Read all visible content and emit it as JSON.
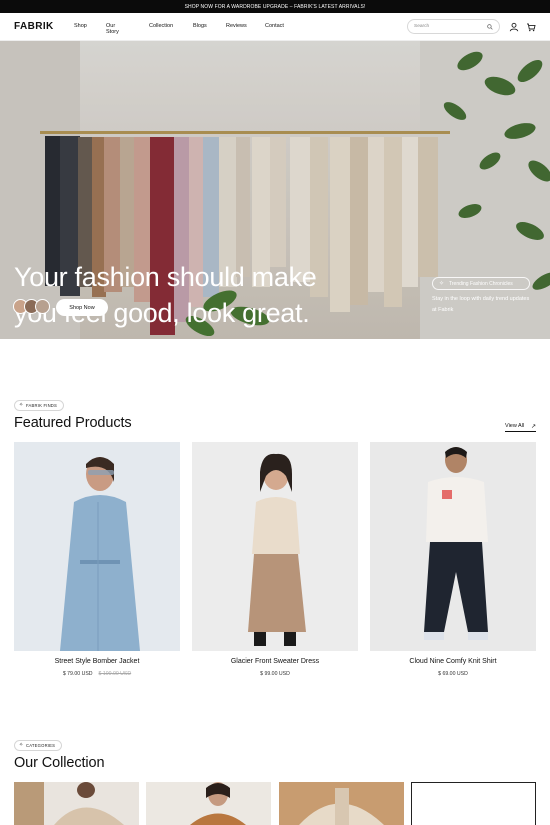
{
  "announcement": "SHOP NOW FOR A WARDROBE UPGRADE – FABRIK'S LATEST ARRIVALS!",
  "brand": "FABRIK",
  "nav": {
    "items": [
      "Shop",
      "Our Story",
      "Collection",
      "Blogs",
      "Reviews",
      "Contact"
    ],
    "search_placeholder": "Search",
    "icons": [
      "search-icon",
      "user-icon",
      "cart-icon"
    ]
  },
  "hero": {
    "title_line1": "Your fashion should make",
    "title_line2": "you feel good, look great.",
    "cta": "Shop Now",
    "trend_pill": "Trending Fashion Chronicles",
    "trend_text": "Stay in the loop with daily trend updates at Fabrik"
  },
  "featured": {
    "tag": "FABRIK FINDS",
    "title": "Featured Products",
    "view_all": "View All",
    "products": [
      {
        "name": "Street Style Bomber Jacket",
        "price": "$ 79.00 USD",
        "old_price": "$ 100.00 USD"
      },
      {
        "name": "Glacier Front Sweater Dress",
        "price": "$ 99.00 USD",
        "old_price": ""
      },
      {
        "name": "Cloud Nine Comfy Knit Shirt",
        "price": "$ 69.00 USD",
        "old_price": ""
      }
    ]
  },
  "collection": {
    "tag": "CATEGORIES",
    "title": "Our Collection"
  },
  "colors": {
    "announcement_bg": "#0b0b0b",
    "page_bg": "#ffffff",
    "text": "#111111"
  }
}
